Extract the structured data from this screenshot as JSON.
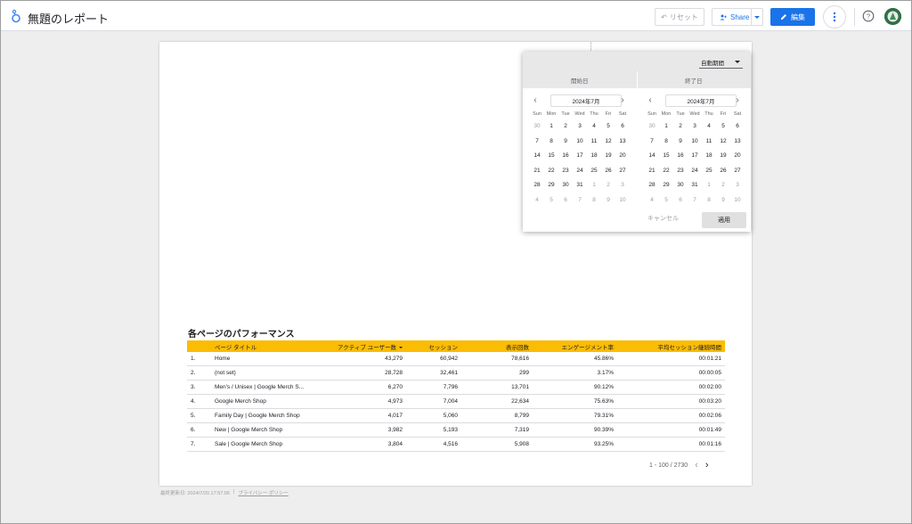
{
  "app": {
    "title": "無題のレポート",
    "reset_label": "リセット",
    "share_label": "Share",
    "edit_label": "編集"
  },
  "date_picker": {
    "period": "自動期間",
    "start_label": "開始日",
    "end_label": "終了日",
    "start_month": "2024年7月",
    "end_month": "2024年7月",
    "weekdays": [
      "Sun",
      "Mon",
      "Tue",
      "Wed",
      "Thu",
      "Fri",
      "Sat"
    ],
    "days": [
      [
        "30",
        "1",
        "2",
        "3",
        "4",
        "5",
        "6"
      ],
      [
        "7",
        "8",
        "9",
        "10",
        "11",
        "12",
        "13"
      ],
      [
        "14",
        "15",
        "16",
        "17",
        "18",
        "19",
        "20"
      ],
      [
        "21",
        "22",
        "23",
        "24",
        "25",
        "26",
        "27"
      ],
      [
        "28",
        "29",
        "30",
        "31",
        "1",
        "2",
        "3"
      ],
      [
        "4",
        "5",
        "6",
        "7",
        "8",
        "9",
        "10"
      ]
    ],
    "cancel_label": "キャンセル",
    "apply_label": "適用"
  },
  "table": {
    "title": "各ページのパフォーマンス",
    "columns": [
      "ページ タイトル",
      "アクティブ ユーザー数",
      "セッション",
      "表示回数",
      "エンゲージメント率",
      "平均セッション継続時間"
    ],
    "rows": [
      [
        "1.",
        "Home",
        "43,279",
        "60,942",
        "78,616",
        "45.86%",
        "00:01:21"
      ],
      [
        "2.",
        "(not set)",
        "28,728",
        "32,461",
        "299",
        "3.17%",
        "00:00:05"
      ],
      [
        "3.",
        "Men's / Unisex | Google Merch S...",
        "6,270",
        "7,796",
        "13,701",
        "90.12%",
        "00:02:00"
      ],
      [
        "4.",
        "Google Merch Shop",
        "4,973",
        "7,004",
        "22,634",
        "75.63%",
        "00:03:20"
      ],
      [
        "5.",
        "Family Day | Google Merch Shop",
        "4,017",
        "5,060",
        "8,799",
        "79.31%",
        "00:02:06"
      ],
      [
        "6.",
        "New | Google Merch Shop",
        "3,982",
        "5,193",
        "7,319",
        "90.39%",
        "00:01:49"
      ],
      [
        "7.",
        "Sale | Google Merch Shop",
        "3,804",
        "4,516",
        "5,908",
        "93.25%",
        "00:01:16"
      ]
    ],
    "pagination": "1 - 100 / 2730"
  },
  "footer": {
    "updated": "最終更新日: 2024/7/20 17:57:06",
    "privacy_link": "プライバシー ポリシー"
  },
  "colors": {
    "header_accent": "#fbbc04",
    "primary": "#1a73e8"
  }
}
